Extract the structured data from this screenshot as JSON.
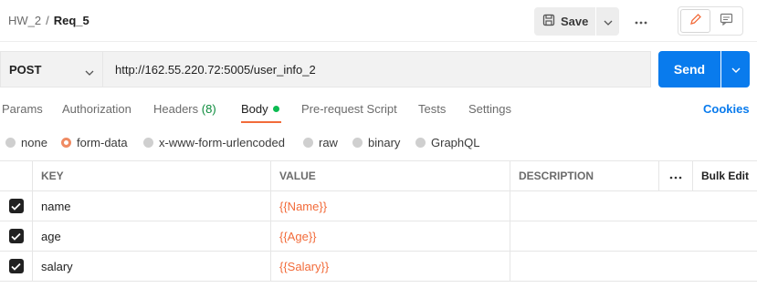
{
  "breadcrumb": {
    "collection": "HW_2",
    "separator": "/",
    "request": "Req_5"
  },
  "toolbar": {
    "save_label": "Save",
    "save_icon": "save-icon",
    "more_icon": "more-horizontal-icon"
  },
  "view_toggle": [
    {
      "icon": "pencil-icon",
      "active": true
    },
    {
      "icon": "comment-icon",
      "active": false
    }
  ],
  "request": {
    "method": "POST",
    "url": "http://162.55.220.72:5005/user_info_2",
    "send_label": "Send"
  },
  "tabs": [
    {
      "label": "Params"
    },
    {
      "label": "Authorization"
    },
    {
      "label": "Headers",
      "count": "(8)"
    },
    {
      "label": "Body",
      "active": true,
      "indicator": "green-dot"
    },
    {
      "label": "Pre-request Script"
    },
    {
      "label": "Tests"
    },
    {
      "label": "Settings"
    }
  ],
  "cookies_label": "Cookies",
  "body_types": [
    {
      "label": "none",
      "selected": false
    },
    {
      "label": "form-data",
      "selected": true
    },
    {
      "label": "x-www-form-urlencoded",
      "selected": false
    },
    {
      "label": "raw",
      "selected": false
    },
    {
      "label": "binary",
      "selected": false
    },
    {
      "label": "GraphQL",
      "selected": false
    }
  ],
  "table": {
    "headers": {
      "key": "KEY",
      "value": "VALUE",
      "description": "DESCRIPTION",
      "bulk_edit": "Bulk Edit"
    },
    "rows": [
      {
        "checked": true,
        "key": "name",
        "value": "{{Name}}",
        "description": ""
      },
      {
        "checked": true,
        "key": "age",
        "value": "{{Age}}",
        "description": ""
      },
      {
        "checked": true,
        "key": "salary",
        "value": "{{Salary}}",
        "description": ""
      }
    ]
  },
  "colors": {
    "accent": "#f26b3a",
    "primary": "#097bed",
    "indicator": "#0cbb52"
  }
}
